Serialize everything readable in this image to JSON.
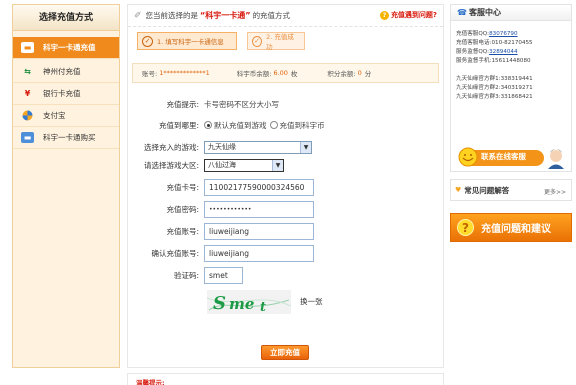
{
  "sidebar": {
    "title": "选择充值方式",
    "items": [
      {
        "label": "科宇一卡通充值",
        "icon": "card-icon",
        "active": true
      },
      {
        "label": "神州付充值",
        "icon": "shenzhoufu-icon",
        "active": false
      },
      {
        "label": "银行卡充值",
        "icon": "yuan-icon",
        "active": false
      },
      {
        "label": "支付宝",
        "icon": "alipay-icon",
        "active": false
      },
      {
        "label": "科宇一卡通购买",
        "icon": "card-buy-icon",
        "active": false
      }
    ]
  },
  "header": {
    "prefix": "您当前选择的是",
    "product": "“科宇一卡通”",
    "suffix": "的充值方式",
    "help_link": "充值遇到问题?"
  },
  "steps": [
    {
      "label": "1. 填写科宇一卡通信息",
      "state": "current"
    },
    {
      "label": "2. 充值成功",
      "state": "pending"
    }
  ],
  "account": {
    "account_label": "账号:",
    "account_value": "1*************1",
    "kb_label": "科宇币余额:",
    "kb_value": "6.00",
    "kb_unit": "枚",
    "points_label": "积分余额:",
    "points_value": "0",
    "points_unit": "分"
  },
  "form": {
    "tip_label": "充值提示:",
    "tip_value": "卡号密码不区分大小写",
    "target_label": "充值到哪里:",
    "target_options": [
      "默认充值到游戏",
      "充值到科宇币"
    ],
    "target_selected": 0,
    "game_label": "选择充入的游戏:",
    "game_value": "九天仙缘",
    "region_label": "请选择游戏大区:",
    "region_value": "八仙过海",
    "card_label": "充值卡号:",
    "card_value": "11002177590000324560",
    "password_label": "充值密码:",
    "password_value": "••••••••••••",
    "user_label": "充值账号:",
    "user_value": "liuweijiang",
    "confirm_label": "确认充值账号:",
    "confirm_value": "liuweijiang",
    "captcha_label": "验证码:",
    "captcha_value": "smet",
    "captcha_image_text": "Smet",
    "refresh_label": "换一张",
    "submit_label": "立即充值"
  },
  "warm_tip": "温馨提示:",
  "service": {
    "title": "客服中心",
    "lines": [
      {
        "label": "充值客服QQ:",
        "value": "83076790",
        "link": true
      },
      {
        "label": "充值客服电话:",
        "value": "010-82170455",
        "link": false
      },
      {
        "label": "服务监督QQ:",
        "value": "32894044",
        "link": true
      },
      {
        "label": "服务监督手机:",
        "value": "15611448080",
        "link": false
      }
    ],
    "groups": [
      {
        "label": "九天仙缘官方群1:",
        "value": "338319441"
      },
      {
        "label": "九天仙缘官方群2:",
        "value": "340319271"
      },
      {
        "label": "九天仙缘官方群3:",
        "value": "331868421"
      }
    ],
    "online_label": "联系在线客服"
  },
  "faq": {
    "title": "常见问题解答",
    "more": "更多>>"
  },
  "suggest": {
    "label": "充值问题和建议"
  },
  "colors": {
    "accent": "#f08a1c",
    "red": "#d8180c",
    "link": "#1b4fa8"
  }
}
